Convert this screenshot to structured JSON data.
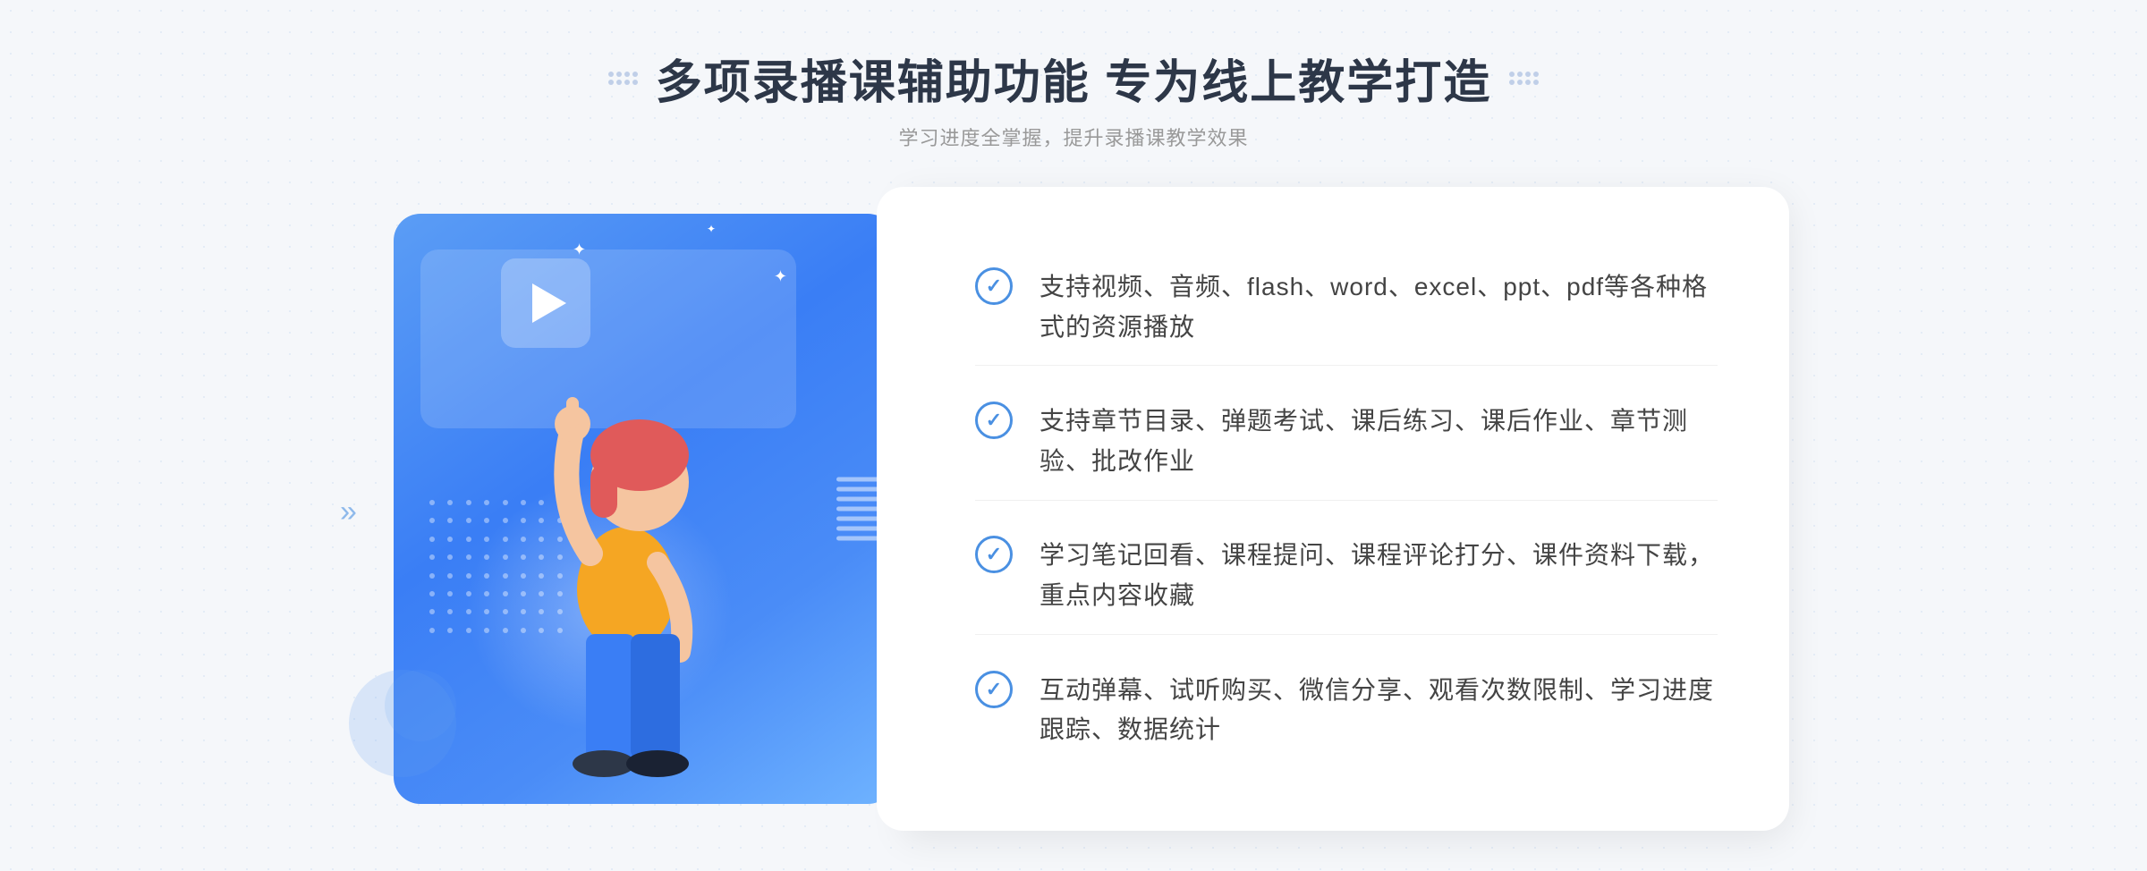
{
  "header": {
    "title": "多项录播课辅助功能 专为线上教学打造",
    "subtitle": "学习进度全掌握，提升录播课教学效果"
  },
  "features": [
    {
      "id": "feature-1",
      "text": "支持视频、音频、flash、word、excel、ppt、pdf等各种格式的资源播放"
    },
    {
      "id": "feature-2",
      "text": "支持章节目录、弹题考试、课后练习、课后作业、章节测验、批改作业"
    },
    {
      "id": "feature-3",
      "text": "学习笔记回看、课程提问、课程评论打分、课件资料下载，重点内容收藏"
    },
    {
      "id": "feature-4",
      "text": "互动弹幕、试听购买、微信分享、观看次数限制、学习进度跟踪、数据统计"
    }
  ],
  "decorative": {
    "left_arrows": "»",
    "check_symbol": "✓"
  }
}
